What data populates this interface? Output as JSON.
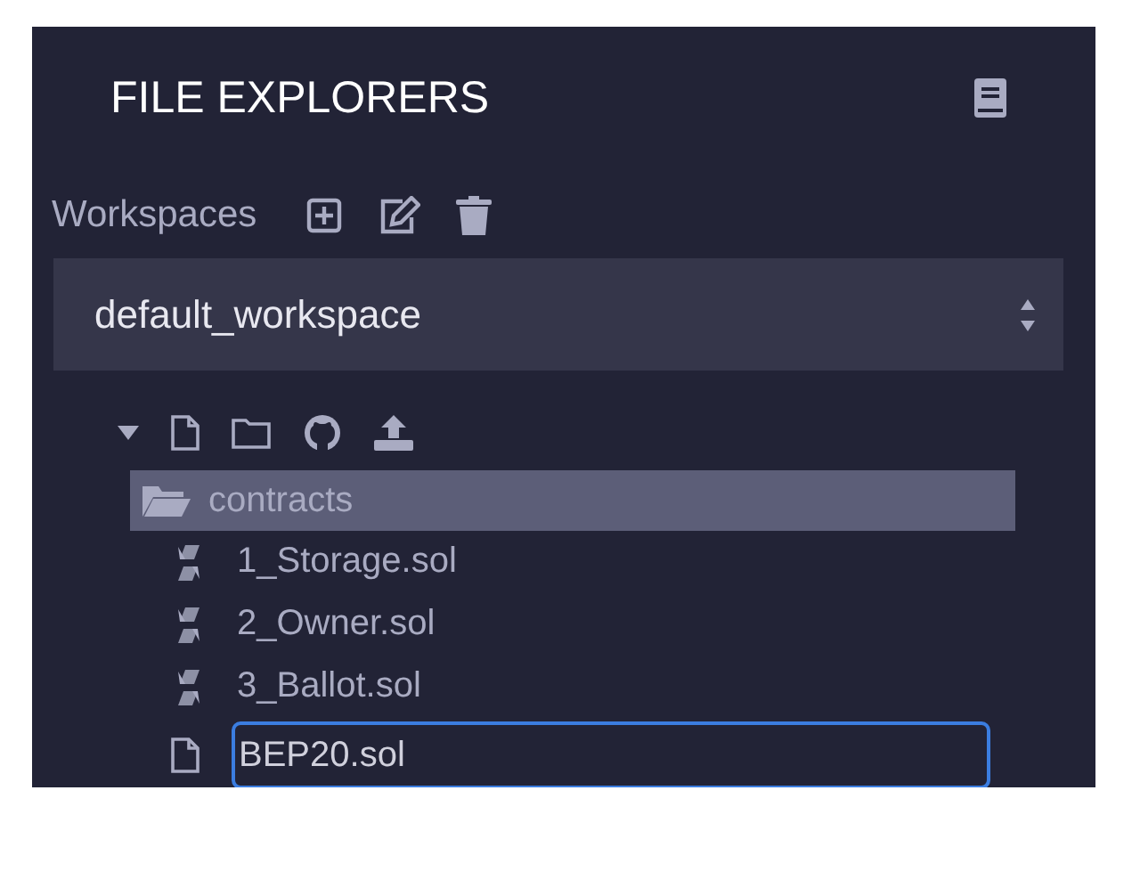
{
  "panel": {
    "title": "FILE EXPLORERS"
  },
  "workspaces": {
    "label": "Workspaces",
    "selected_workspace": "default_workspace"
  },
  "tree": {
    "expanded": true,
    "items": [
      {
        "kind": "folder",
        "name": "contracts",
        "selected": true,
        "expanded": true,
        "children": [
          {
            "kind": "solidity",
            "name": "1_Storage.sol",
            "selected": false
          },
          {
            "kind": "solidity",
            "name": "2_Owner.sol",
            "selected": false
          },
          {
            "kind": "solidity",
            "name": "3_Ballot.sol",
            "selected": false
          },
          {
            "kind": "new_file",
            "value": "BEP20.sol"
          }
        ]
      }
    ]
  }
}
